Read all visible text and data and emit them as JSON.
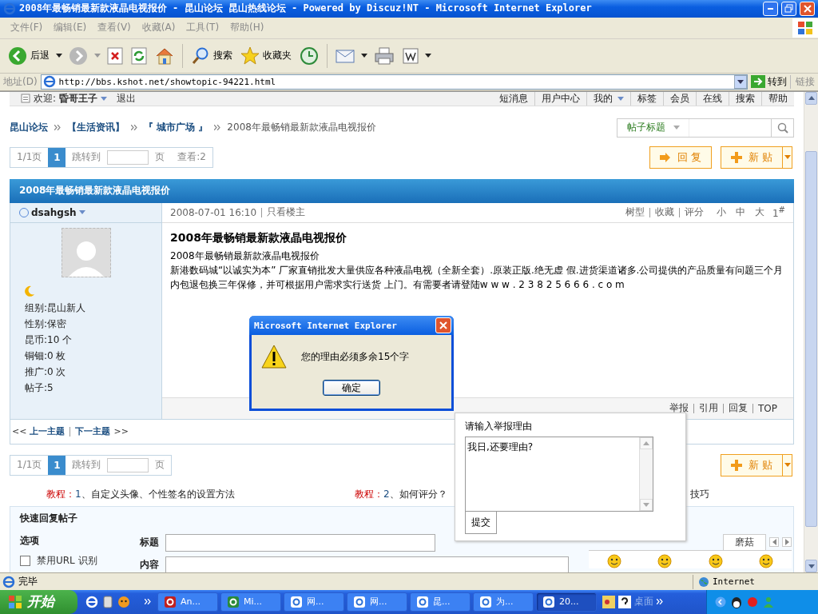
{
  "window": {
    "title": "2008年最畅销最新款液晶电视报价 - 昆山论坛 昆山热线论坛 - Powered by Discuz!NT - Microsoft Internet Explorer"
  },
  "menu": [
    "文件(F)",
    "编辑(E)",
    "查看(V)",
    "收藏(A)",
    "工具(T)",
    "帮助(H)"
  ],
  "toolbar": [
    {
      "kind": "back",
      "label": "后退"
    },
    {
      "kind": "forward"
    },
    {
      "kind": "stop"
    },
    {
      "kind": "refresh"
    },
    {
      "kind": "home"
    },
    {
      "kind": "search",
      "label": "搜索"
    },
    {
      "kind": "favorites",
      "label": "收藏夹"
    },
    {
      "kind": "history"
    },
    {
      "kind": "mail"
    },
    {
      "kind": "print"
    },
    {
      "kind": "edit"
    }
  ],
  "address": {
    "label": "地址(D)",
    "url": "http://bbs.kshot.net/showtopic-94221.html",
    "go": "转到",
    "links": "链接"
  },
  "forum": {
    "welcome": "欢迎:",
    "user": "昏哥王子",
    "logout": "退出",
    "nav": [
      "短消息",
      "用户中心",
      "我的",
      "标签",
      "会员",
      "在线",
      "搜索",
      "帮助"
    ],
    "breadcrumb": [
      "昆山论坛",
      "【生活资讯】",
      "『 城市广场 』",
      "2008年最畅销最新款液晶电视报价"
    ],
    "search_type": "帖子标题",
    "pager": {
      "pages": "1/1页",
      "current": "1",
      "jump": "跳转到",
      "unit": "页",
      "views": "查看:2"
    },
    "reply_button": "回 复",
    "new_button": "新 贴",
    "thread_title": "2008年最畅销最新款液晶电视报价",
    "post": {
      "author": "dsahgsh",
      "date": "2008-07-01 16:10",
      "only_author": "只看楼主",
      "tools": [
        "树型",
        "收藏",
        "评分"
      ],
      "font_sizes": [
        "小",
        "中",
        "大"
      ],
      "floor": "1$^{#}$",
      "profile": [
        "组别:昆山新人",
        "性别:保密",
        "昆币:10 个",
        "铜钿:0 枚",
        "推广:0 次",
        "帖子:5"
      ],
      "title": "2008年最畅销最新款液晶电视报价",
      "body": [
        "2008年最畅销最新款液晶电视报价",
        "新港数码城“以诚实为本” 厂家直销批发大量供应各种液晶电视（全新全套）.原装正版.绝无虚 假.进货渠道诸多.公司提供的产品质量有问题三个月内包退包换三年保修，并可根据用户需求实行送货 上门。有需要者请登陆w w w . 2 3 8 2 5 6 6 6 . c o m"
      ],
      "actions": [
        "举报",
        "引用",
        "回复",
        "TOP"
      ]
    },
    "thread_nav": {
      "prev_mark": "<<",
      "prev": "上一主题",
      "next": "下一主题",
      "next_mark": ">>"
    },
    "pager_bottom": {
      "pages": "1/1页",
      "current": "1",
      "jump": "跳转到",
      "unit": "页"
    },
    "new_button_bottom": "新 贴",
    "tips": [
      {
        "label": "教程：",
        "number": "1",
        "text": "、自定义头像、个性签名的设置方法"
      },
      {
        "label": "教程：",
        "number": "2",
        "text": "、如何评分？"
      }
    ],
    "tip_tail": "技巧",
    "quick_reply": {
      "title": "快速回复帖子",
      "options": "选项",
      "disable_url": {
        "label": "禁用URL 识别",
        "checked": false
      },
      "subject_label": "标题",
      "content_label": "内容",
      "smiley_tab": "磨菇"
    }
  },
  "alert": {
    "title": "Microsoft Internet Explorer",
    "message": "您的理由必须多余15个字",
    "ok": "确定"
  },
  "report": {
    "label": "请输入举报理由",
    "value": "我日,还要理由?",
    "submit": "提交"
  },
  "status": {
    "text": "完毕",
    "zone": "Internet"
  },
  "taskbar": {
    "start": "开始",
    "tasks": [
      {
        "label": "An...",
        "selected": false
      },
      {
        "label": "Mi...",
        "selected": false
      },
      {
        "label": "网...",
        "selected": false
      },
      {
        "label": "网...",
        "selected": false
      },
      {
        "label": "昆...",
        "selected": false
      },
      {
        "label": "为...",
        "selected": false
      },
      {
        "label": "20...",
        "selected": true
      }
    ],
    "desktop": "桌面"
  }
}
